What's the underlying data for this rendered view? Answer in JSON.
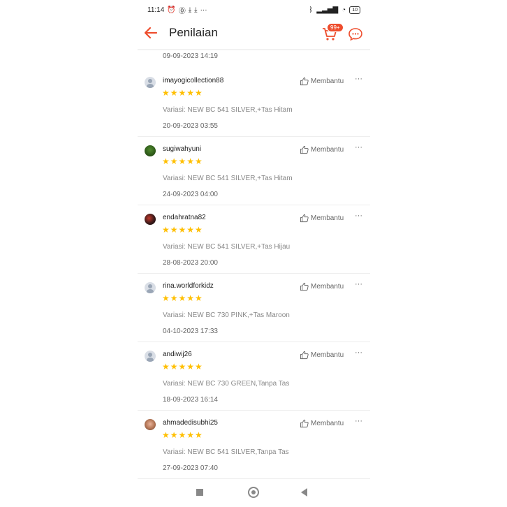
{
  "status_bar": {
    "time": "11:14",
    "battery": "10"
  },
  "header": {
    "title": "Penilaian",
    "cart_badge": "99+"
  },
  "previous_review_date": "09-09-2023 14:19",
  "helpful_label": "Membantu",
  "more_label": "···",
  "rating_stars": "★★★★★",
  "reviews": [
    {
      "username": "imayogicollection88",
      "variation": "Variasi: NEW BC 541 SILVER,+Tas Hitam",
      "date": "20-09-2023 03:55",
      "avatar": "default-avatar"
    },
    {
      "username": "sugiwahyuni",
      "variation": "Variasi: NEW BC 541 SILVER,+Tas Hitam",
      "date": "24-09-2023 04:00",
      "avatar": "photo-avatar"
    },
    {
      "username": "endahratna82",
      "variation": "Variasi: NEW BC 541 SILVER,+Tas Hijau",
      "date": "28-08-2023 20:00",
      "avatar": "photo-avatar"
    },
    {
      "username": "rina.worldforkidz",
      "variation": "Variasi: NEW BC 730 PINK,+Tas Maroon",
      "date": "04-10-2023 17:33",
      "avatar": "default-avatar"
    },
    {
      "username": "andiwij26",
      "variation": "Variasi: NEW BC 730 GREEN,Tanpa Tas",
      "date": "18-09-2023 16:14",
      "avatar": "default-avatar"
    },
    {
      "username": "ahmadedisubhi25",
      "variation": "Variasi: NEW BC 541 SILVER,Tanpa Tas",
      "date": "27-09-2023 07:40",
      "avatar": "photo-avatar"
    }
  ],
  "colors": {
    "accent": "#ee4d2d",
    "star": "#ffbf00"
  }
}
